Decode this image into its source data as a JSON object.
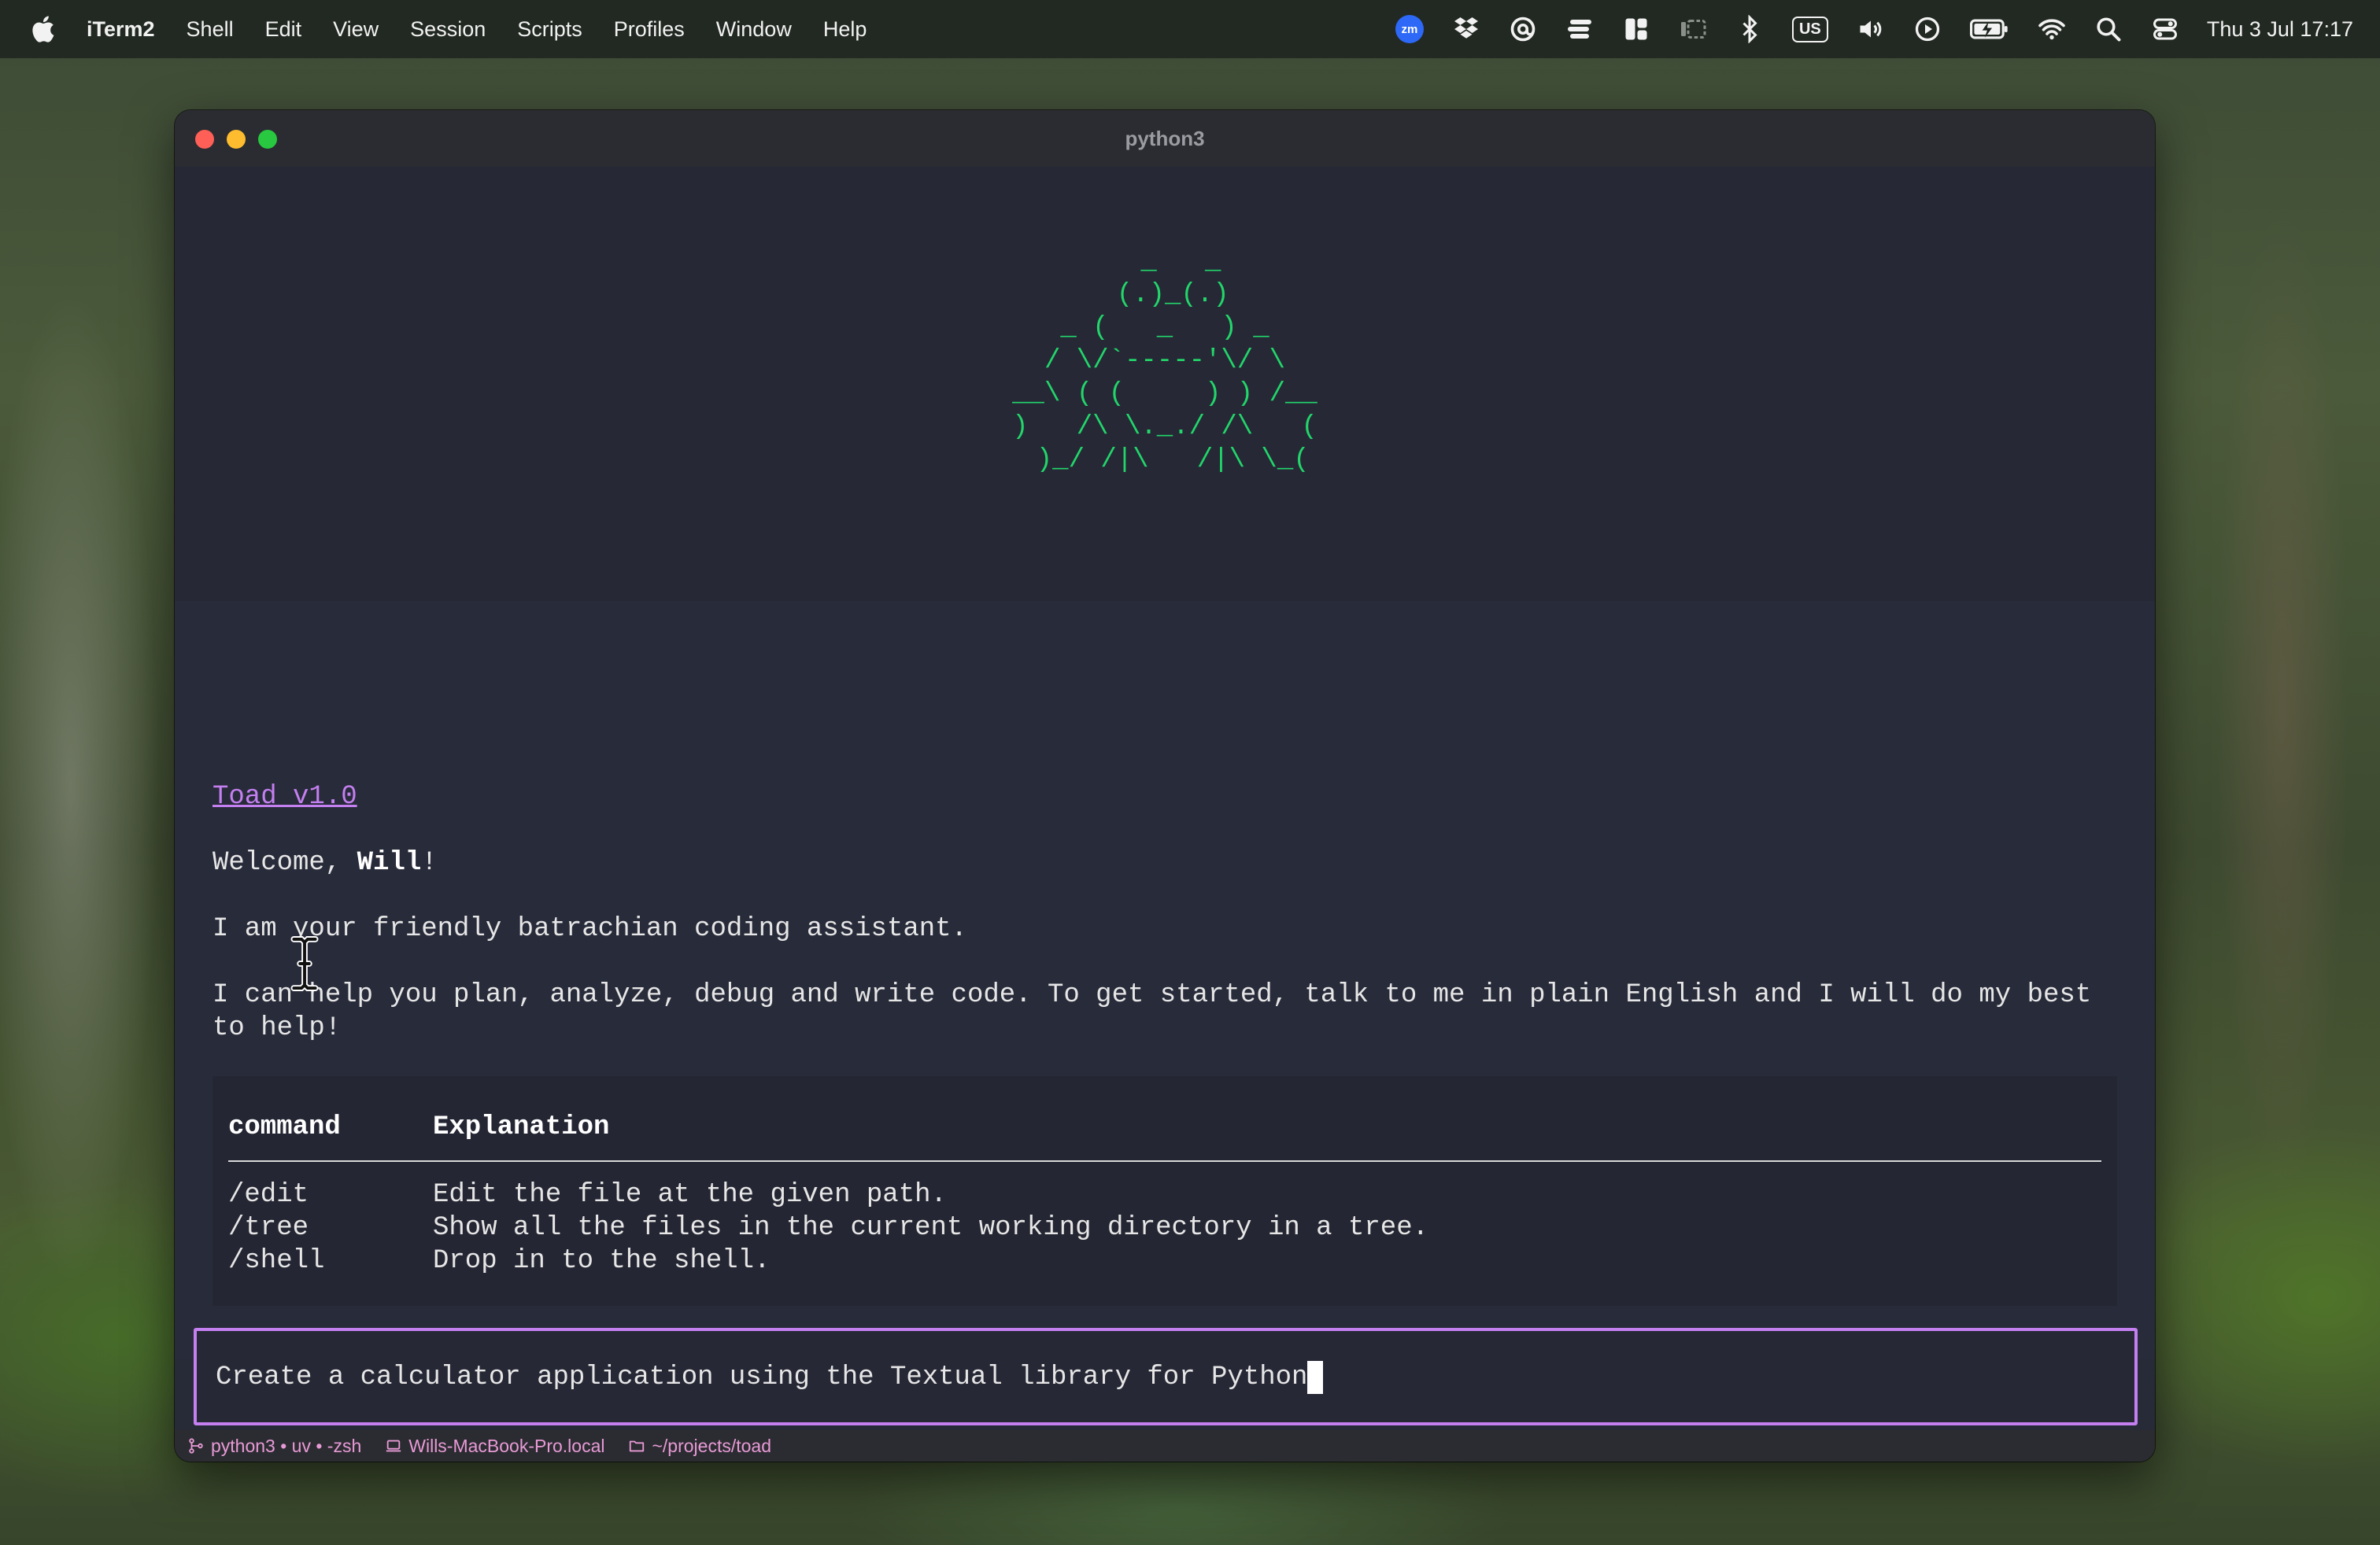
{
  "menubar": {
    "app_name": "iTerm2",
    "menus": [
      "Shell",
      "Edit",
      "View",
      "Session",
      "Scripts",
      "Profiles",
      "Window",
      "Help"
    ],
    "status_icons": [
      "zoom-icon",
      "dropbox-icon",
      "at-sign-icon",
      "stack-icon",
      "layout-icon",
      "screen-mirror-icon",
      "bluetooth-icon",
      "keyboard-layout-icon",
      "volume-icon",
      "play-icon",
      "battery-charging-icon",
      "wifi-icon",
      "search-icon",
      "control-center-icon"
    ],
    "zoom_label": "zm",
    "keyboard_layout": "US",
    "clock": "Thu 3 Jul  17:17"
  },
  "window": {
    "title": "python3"
  },
  "banner": {
    "ascii_art": "  _   _\n (.)_(.)\n_ (   _   ) _\n/ \\/`-----'\\/ \\\n__\\ ( (     ) ) /__\n)   /\\ \\._./ /\\   (\n )_/ /|\\   /|\\ \\_(",
    "color": "#22d66a"
  },
  "content": {
    "version_link": "Toad v1.0",
    "welcome_prefix": "Welcome, ",
    "welcome_name": "Will",
    "welcome_suffix": "!",
    "intro": "I am your friendly batrachian coding assistant.",
    "help": "I can help you plan, analyze, debug and write code. To get started, talk to me in plain English and I will do my best to help!",
    "table": {
      "headers": [
        "command",
        "Explanation"
      ],
      "rows": [
        {
          "command": "/edit",
          "explanation": "Edit the file at the given path."
        },
        {
          "command": "/tree",
          "explanation": "Show all the files in the current working directory in a tree."
        },
        {
          "command": "/shell",
          "explanation": "Drop in to the shell."
        }
      ]
    }
  },
  "prompt": {
    "value": "Create a calculator application using the Textual library for Python",
    "accent": "#c47ff0"
  },
  "statusbar": {
    "job": "python3 • uv • -zsh",
    "host": "Wills-MacBook-Pro.local",
    "path": "~/projects/toad"
  }
}
